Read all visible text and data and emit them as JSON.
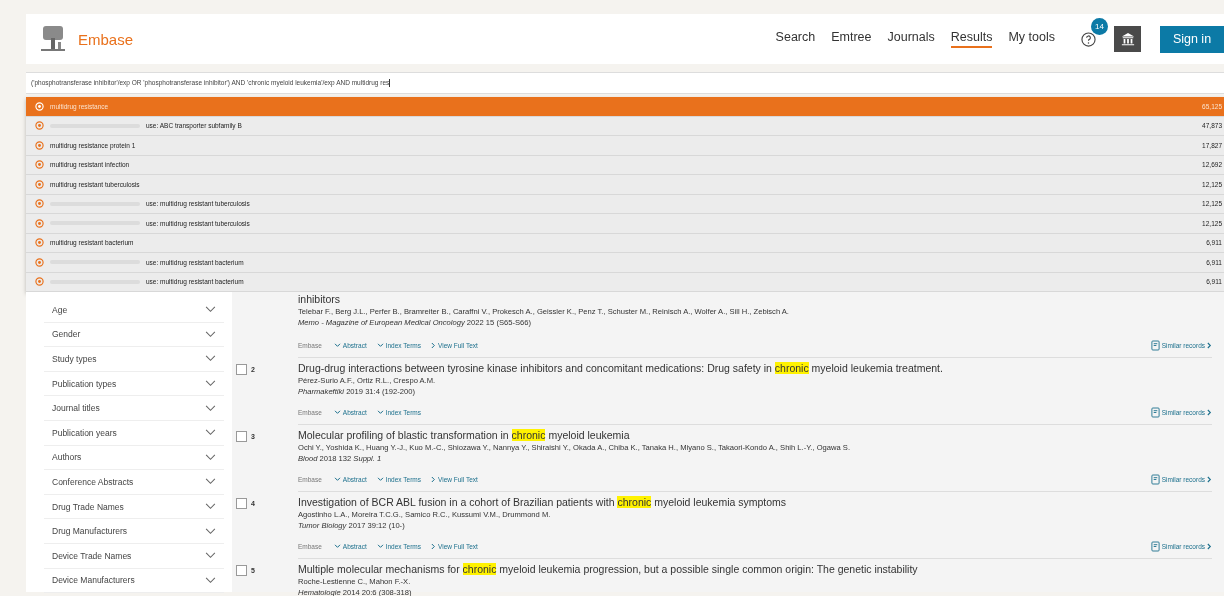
{
  "header": {
    "brand": "Embase",
    "nav": [
      {
        "label": "Search",
        "selected": false
      },
      {
        "label": "Emtree",
        "selected": false
      },
      {
        "label": "Journals",
        "selected": false
      },
      {
        "label": "Results",
        "selected": true
      },
      {
        "label": "My tools",
        "selected": false
      }
    ],
    "notification_count": "14",
    "sign_in": "Sign in"
  },
  "search": {
    "value": "('phosphotransferase inhibitor'/exp OR 'phosphotransferase inhibitor') AND 'chronic myeloid leukemia'/exp AND multidrug res"
  },
  "suggestions": [
    {
      "kind": "term",
      "text": "multidrug resistance",
      "count": "65,125",
      "selected": true
    },
    {
      "kind": "synonym",
      "text": "use: ABC transporter subfamily B",
      "count": "47,873",
      "selected": false
    },
    {
      "kind": "term",
      "text": "multidrug resistance protein 1",
      "count": "17,827",
      "selected": false
    },
    {
      "kind": "term",
      "text": "multidrug resistant infection",
      "count": "12,692",
      "selected": false
    },
    {
      "kind": "term",
      "text": "multidrug resistant tuberculosis",
      "count": "12,125",
      "selected": false
    },
    {
      "kind": "synonym",
      "text": "use: multidrug resistant tuberculosis",
      "count": "12,125",
      "selected": false
    },
    {
      "kind": "synonym",
      "text": "use: multidrug resistant tuberculosis",
      "count": "12,125",
      "selected": false
    },
    {
      "kind": "term",
      "text": "multidrug resistant bacterium",
      "count": "6,911",
      "selected": false
    },
    {
      "kind": "synonym",
      "text": "use: multidrug resistant bacterium",
      "count": "6,911",
      "selected": false
    },
    {
      "kind": "synonym",
      "text": "use: multidrug resistant bacterium",
      "count": "6,911",
      "selected": false
    }
  ],
  "filters": [
    "Age",
    "Gender",
    "Study types",
    "Publication types",
    "Journal titles",
    "Publication years",
    "Authors",
    "Conference Abstracts",
    "Drug Trade Names",
    "Drug Manufacturers",
    "Device Trade Names",
    "Device Manufacturers"
  ],
  "results": [
    {
      "title": [
        {
          "text": "inhibitors",
          "highlight": false
        }
      ],
      "authors": "Telebar F., Berg J.L., Perfer B., Bramreiter B., Caraffni V., Prokesch A., Geissler K., Penz T., Schuster M., Reinisch A., Wolfer A., Sill H., Zebisch A.",
      "journal": "*Memo - Magazine of European Medical Oncology* 2022 15 (S65-S66)",
      "source": "Embase",
      "links": [
        {
          "kind": "expand",
          "label": "Abstract"
        },
        {
          "kind": "expand",
          "label": "Index Terms"
        },
        {
          "kind": "open",
          "label": "View Full Text"
        }
      ],
      "similar": "Similar records"
    },
    {
      "number": "2",
      "checked": false,
      "title": [
        {
          "text": "Drug-drug interactions between tyrosine kinase inhibitors and concomitant medications: Drug safety in ",
          "highlight": false
        },
        {
          "text": "chronic",
          "highlight": true
        },
        {
          "text": " myeloid leukemia treatment.",
          "highlight": false
        }
      ],
      "authors": "Pérez-Surio A.F., Ortiz R.L., Crespo A.M.",
      "journal": "*Pharmakeftiki* 2019 31:4 (192-200)",
      "source": "Embase",
      "links": [
        {
          "kind": "expand",
          "label": "Abstract"
        },
        {
          "kind": "expand",
          "label": "Index Terms"
        }
      ],
      "similar": "Similar records"
    },
    {
      "number": "3",
      "checked": false,
      "title": [
        {
          "text": "Molecular profiling of blastic transformation in ",
          "highlight": false
        },
        {
          "text": "chronic",
          "highlight": true
        },
        {
          "text": " myeloid leukemia",
          "highlight": false
        }
      ],
      "authors": "Ochi Y., Yoshida K., Huang Y.-J., Kuo M.-C., Shiozawa Y., Nannya Y., Shiraishi Y., Okada A., Chiba K., Tanaka H., Miyano S., Takaori-Kondo A., Shih L.-Y., Ogawa S.",
      "journal": "*Blood* 2018 132 *Suppl. 1*",
      "source": "Embase",
      "links": [
        {
          "kind": "expand",
          "label": "Abstract"
        },
        {
          "kind": "expand",
          "label": "Index Terms"
        },
        {
          "kind": "open",
          "label": "View Full Text"
        }
      ],
      "similar": "Similar records"
    },
    {
      "number": "4",
      "checked": false,
      "title": [
        {
          "text": "Investigation of BCR ABL fusion in a cohort of Brazilian patients with ",
          "highlight": false
        },
        {
          "text": "chronic",
          "highlight": true
        },
        {
          "text": " myeloid leukemia symptoms",
          "highlight": false
        }
      ],
      "authors": "Agostinho L.A., Moreira T.C.G., Samico R.C., Kussumi V.M., Drummond M.",
      "journal": "*Tumor Biology* 2017 39:12 (10-)",
      "source": "Embase",
      "links": [
        {
          "kind": "expand",
          "label": "Abstract"
        },
        {
          "kind": "expand",
          "label": "Index Terms"
        },
        {
          "kind": "open",
          "label": "View Full Text"
        }
      ],
      "similar": "Similar records"
    },
    {
      "number": "5",
      "checked": false,
      "title": [
        {
          "text": "Multiple molecular mechanisms for ",
          "highlight": false
        },
        {
          "text": "chronic",
          "highlight": true
        },
        {
          "text": " myeloid leukemia progression, but a possible single common origin: The genetic instability",
          "highlight": false
        }
      ],
      "authors": "Roche-Lestienne C., Mahon F.-X.",
      "journal": "*Hematologie* 2014 20:6 (308-318)"
    }
  ]
}
